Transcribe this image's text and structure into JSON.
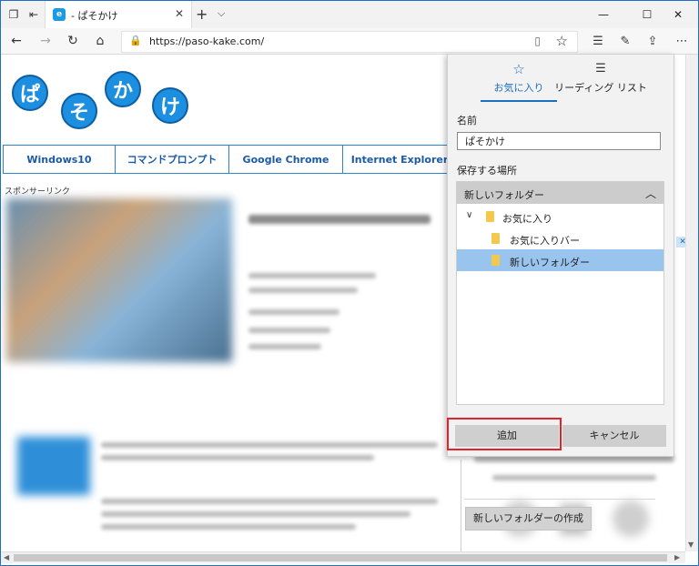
{
  "tab": {
    "title": "- ぱそかけ",
    "favicon": "e"
  },
  "address": {
    "url": "https://paso-kake.com/"
  },
  "site": {
    "logo_chars": [
      "ぱ",
      "そ",
      "か",
      "け"
    ],
    "menu": [
      "Windows10",
      "コマンドプロンプト",
      "Google Chrome",
      "Internet Explorer"
    ],
    "sponsor": "スポンサーリンク"
  },
  "panel": {
    "tab_favorites": "お気に入り",
    "tab_reading": "リーディング リスト",
    "name_label": "名前",
    "name_value": "ぱそかけ",
    "save_label": "保存する場所",
    "tree_header": "新しいフォルダー",
    "tree": [
      {
        "label": "お気に入り"
      },
      {
        "label": "お気に入りバー"
      },
      {
        "label": "新しいフォルダー",
        "selected": true
      }
    ],
    "create_folder": "新しいフォルダーの作成",
    "add": "追加",
    "cancel": "キャンセル"
  },
  "colors": {
    "accent": "#1a6fbf",
    "highlight_box": "#e8202a",
    "selected_row": "#99c4ee"
  },
  "icons": [
    "tab-manager-icon",
    "set-aside-icon",
    "close-icon",
    "new-tab-icon",
    "tab-menu-icon",
    "minimize-icon",
    "maximize-icon",
    "window-close-icon",
    "back-icon",
    "forward-icon",
    "refresh-icon",
    "home-icon",
    "lock-icon",
    "reading-view-icon",
    "favorite-star-icon",
    "favorites-hub-icon",
    "notes-pen-icon",
    "share-icon",
    "more-icon",
    "reading-list-icon",
    "folder-icon",
    "chevron-up-icon",
    "chevron-down-icon"
  ]
}
